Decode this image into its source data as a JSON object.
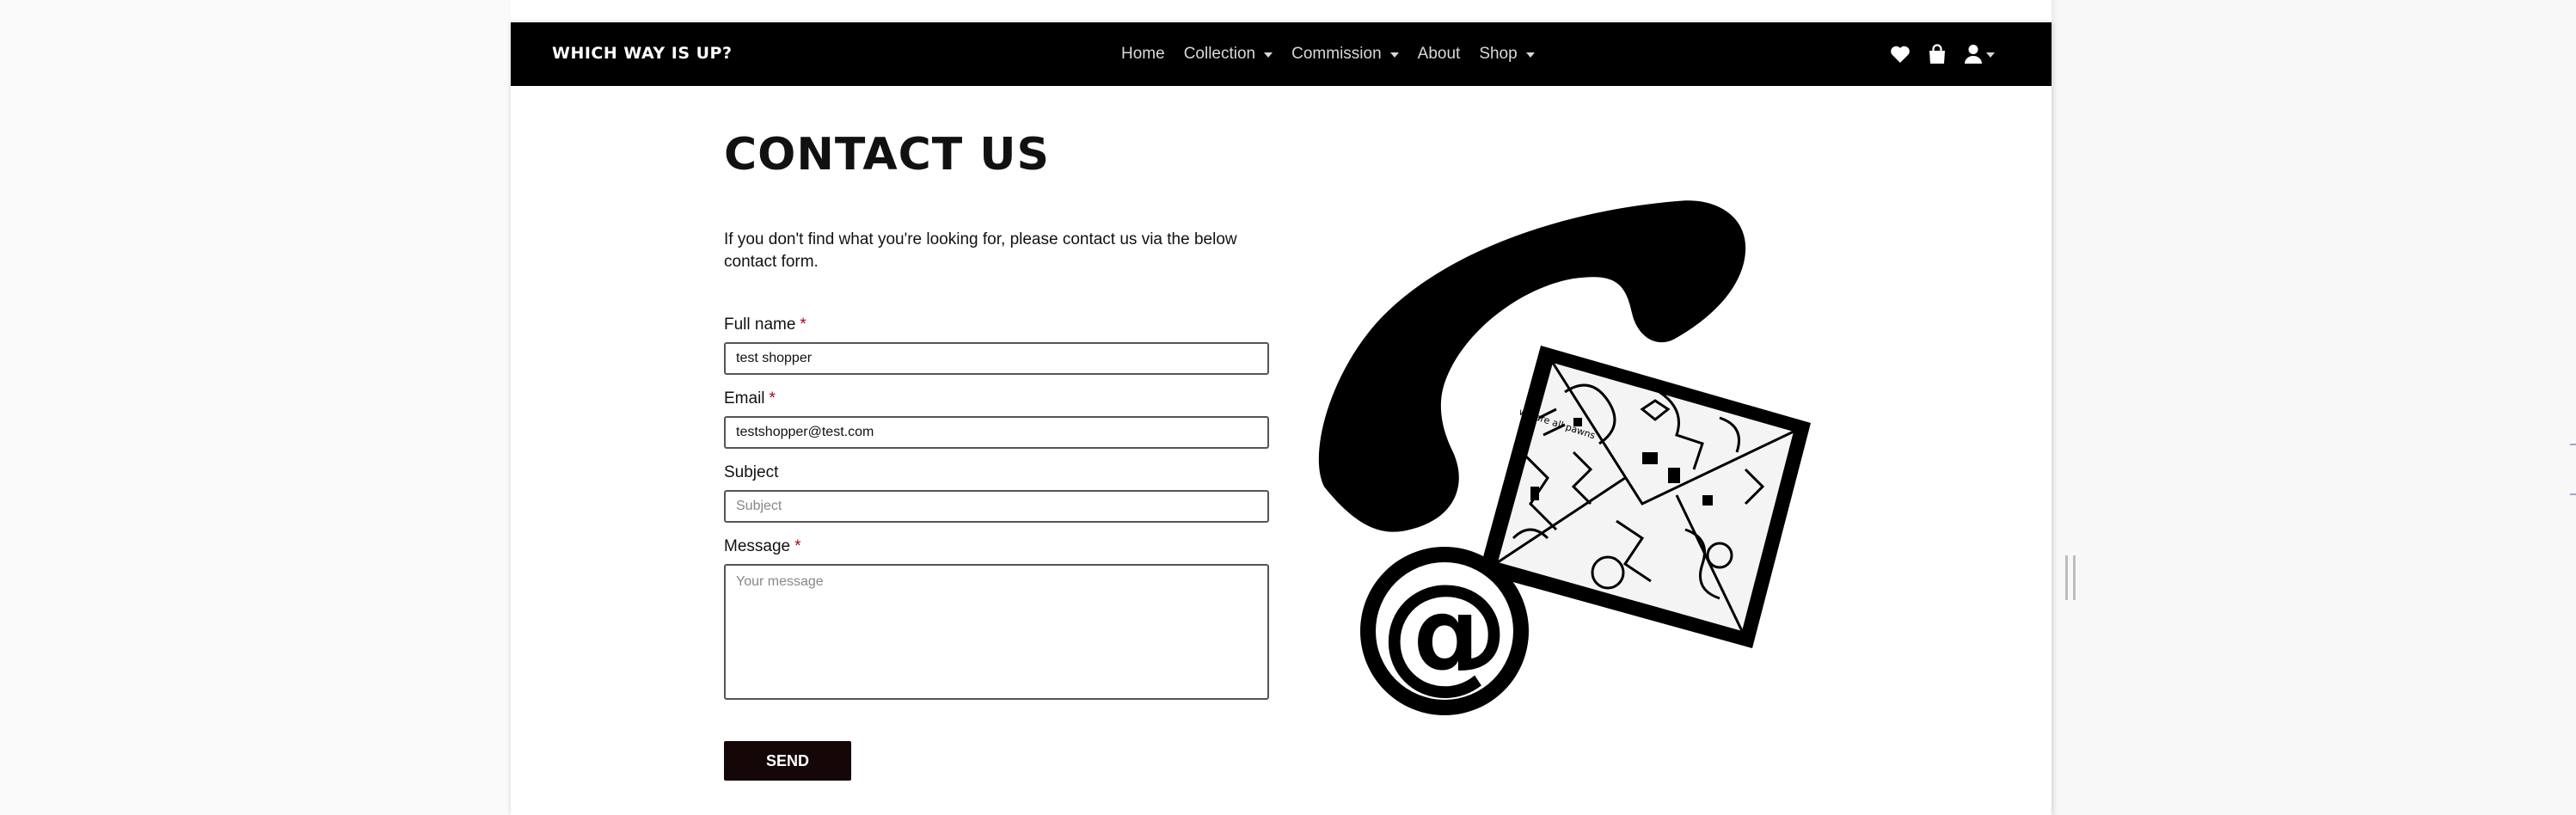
{
  "brand": {
    "name": "Which Way Is Up?"
  },
  "nav": {
    "links": [
      {
        "label": "Home",
        "has_dropdown": false
      },
      {
        "label": "Collection",
        "has_dropdown": true
      },
      {
        "label": "Commission",
        "has_dropdown": true
      },
      {
        "label": "About",
        "has_dropdown": false
      },
      {
        "label": "Shop",
        "has_dropdown": true
      }
    ],
    "icons": [
      "heart-icon",
      "shopping-bag-icon",
      "user-icon"
    ]
  },
  "page": {
    "title": "Contact Us",
    "intro": "If you don't find what you're looking for, please contact us via the below contact form."
  },
  "form": {
    "required_mark": "*",
    "full_name": {
      "label": "Full name",
      "value": "test shopper",
      "required": true
    },
    "email": {
      "label": "Email",
      "value": "testshopper@test.com",
      "required": true
    },
    "subject": {
      "label": "Subject",
      "placeholder": "Subject",
      "value": "",
      "required": false
    },
    "message": {
      "label": "Message",
      "placeholder": "Your message",
      "value": "",
      "required": true
    },
    "submit_label": "Send"
  },
  "illustration": {
    "lettering": "we are all pawns",
    "at_symbol": "@"
  },
  "colors": {
    "navbar_bg": "#000000",
    "button_bg": "#150707",
    "required": "#b00020"
  }
}
